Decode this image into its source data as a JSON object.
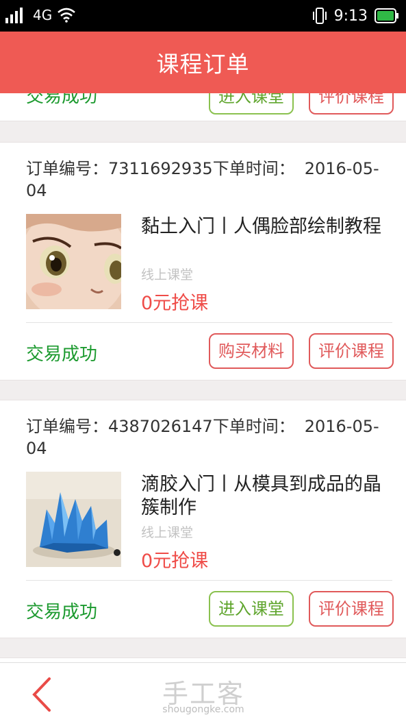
{
  "status_bar": {
    "network": "4G",
    "time": "9:13"
  },
  "header": {
    "title": "课程订单"
  },
  "orders": [
    {
      "status": "交易成功",
      "buttons": [
        "进入课堂",
        "评价课程"
      ]
    },
    {
      "order_no_label": "订单编号：",
      "order_no": "7311692935",
      "time_label": "下单时间：",
      "date": "2016-05-04",
      "course_title": "黏土入门丨人偶脸部绘制教程",
      "course_type": "线上课堂",
      "price": "0元抢课",
      "status": "交易成功",
      "buttons": [
        "购买材料",
        "评价课程"
      ]
    },
    {
      "order_no_label": "订单编号：",
      "order_no": "4387026147",
      "time_label": "下单时间：",
      "date": "2016-05-04",
      "course_title": "滴胶入门丨从模具到成品的晶簇制作",
      "course_type": "线上课堂",
      "price": "0元抢课",
      "status": "交易成功",
      "buttons": [
        "进入课堂",
        "评价课程"
      ]
    }
  ],
  "bottom_bar": {
    "logo": "手工客",
    "url": "shougongke.com"
  },
  "colors": {
    "header_bg": "#ef5a54",
    "success_green": "#1c9a2f",
    "price_red": "#ef4c48",
    "button_green": "#8ac14e",
    "button_red": "#e0595a"
  }
}
